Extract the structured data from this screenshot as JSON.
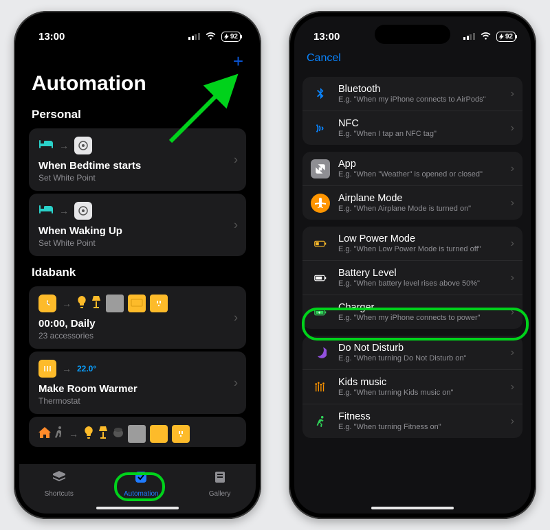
{
  "status": {
    "time": "13:00",
    "battery": "92"
  },
  "phone1": {
    "title": "Automation",
    "sections": {
      "personal_label": "Personal",
      "idabank_label": "Idabank"
    },
    "personal": [
      {
        "title": "When Bedtime starts",
        "sub": "Set White Point"
      },
      {
        "title": "When Waking Up",
        "sub": "Set White Point"
      }
    ],
    "idabank": [
      {
        "title": "00:00, Daily",
        "sub": "23 accessories"
      },
      {
        "title": "Make Room Warmer",
        "sub": "Thermostat",
        "temp": "22.0°"
      }
    ],
    "tabs": {
      "shortcuts": "Shortcuts",
      "automation": "Automation",
      "gallery": "Gallery"
    }
  },
  "phone2": {
    "cancel": "Cancel",
    "groups": [
      [
        {
          "icon": "bluetooth",
          "title": "Bluetooth",
          "sub": "E.g. \"When my iPhone connects to AirPods\""
        },
        {
          "icon": "nfc",
          "title": "NFC",
          "sub": "E.g. \"When I tap an NFC tag\""
        }
      ],
      [
        {
          "icon": "app",
          "title": "App",
          "sub": "E.g. \"When \"Weather\" is opened or closed\""
        },
        {
          "icon": "airplane",
          "title": "Airplane Mode",
          "sub": "E.g. \"When Airplane Mode is turned on\""
        }
      ],
      [
        {
          "icon": "lowpower",
          "title": "Low Power Mode",
          "sub": "E.g. \"When Low Power Mode is turned off\""
        },
        {
          "icon": "battery",
          "title": "Battery Level",
          "sub": "E.g. \"When battery level rises above 50%\""
        },
        {
          "icon": "charger",
          "title": "Charger",
          "sub": "E.g. \"When my iPhone connects to power\""
        }
      ],
      [
        {
          "icon": "dnd",
          "title": "Do Not Disturb",
          "sub": "E.g. \"When turning Do Not Disturb on\""
        },
        {
          "icon": "kids",
          "title": "Kids music",
          "sub": "E.g. \"When turning Kids music on\""
        },
        {
          "icon": "fitness",
          "title": "Fitness",
          "sub": "E.g. \"When turning Fitness on\""
        }
      ]
    ]
  },
  "annotations": {
    "highlight_row": "Battery Level",
    "highlight_tab": "Automation"
  }
}
